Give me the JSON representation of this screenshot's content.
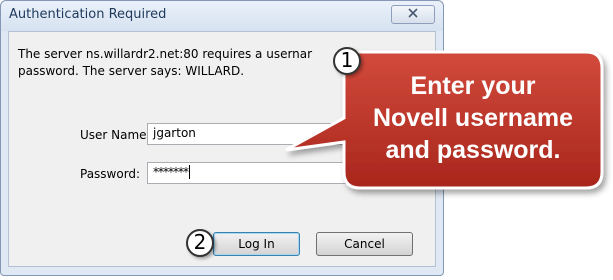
{
  "dialog": {
    "title": "Authentication Required",
    "close_glyph": "☒",
    "message_line1": "The server ns.willardr2.net:80 requires a usernar",
    "message_line2": "password. The server says: WILLARD.",
    "username_label": "User Name:",
    "username_value": "jgarton",
    "password_label": "Password:",
    "password_value": "*******",
    "login_label": "Log In",
    "cancel_label": "Cancel"
  },
  "annotations": {
    "step1": "1",
    "step2": "2",
    "callout_lines": [
      "Enter your",
      "Novell username",
      "and password."
    ],
    "callout_color": "#c0392b"
  }
}
